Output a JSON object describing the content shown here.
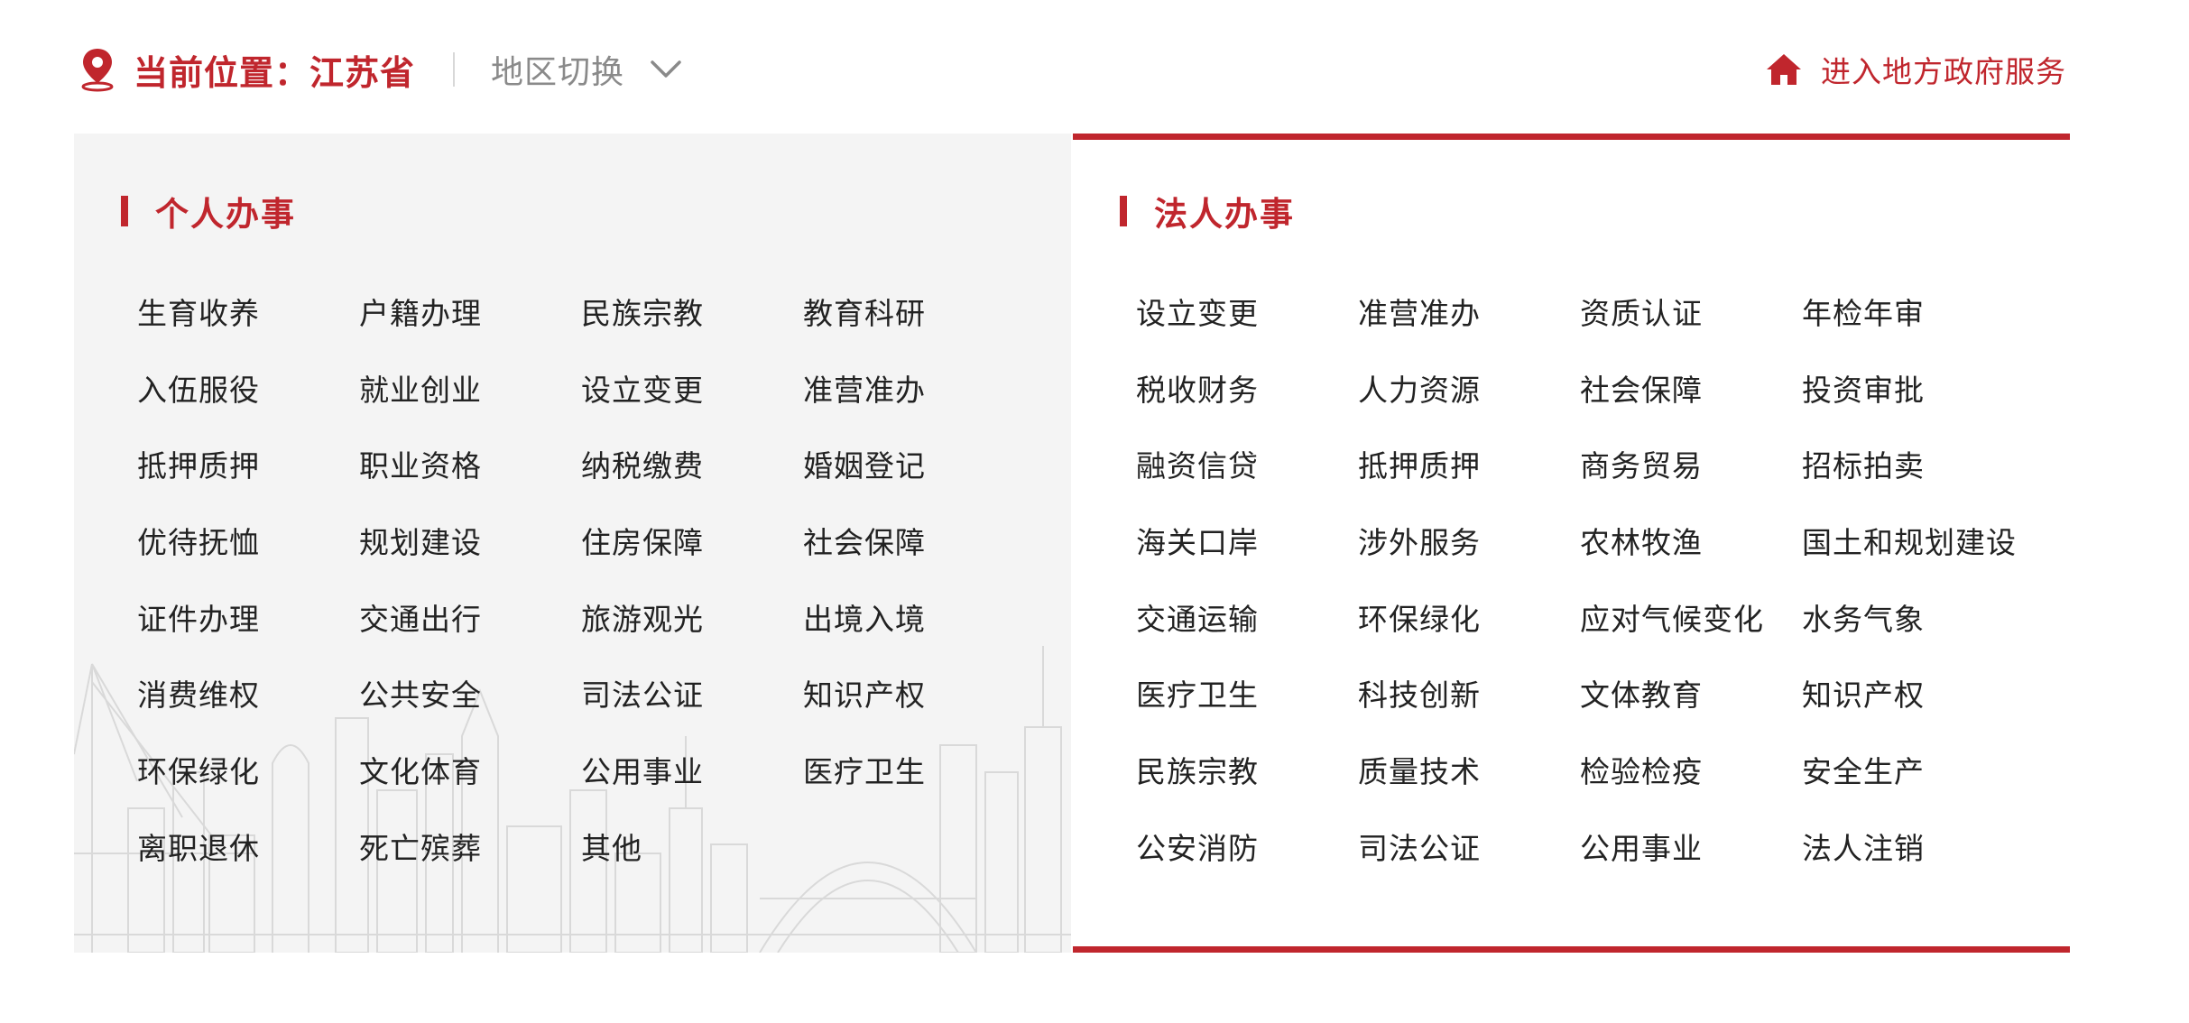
{
  "header": {
    "location_label": "当前位置：",
    "location_value": "江苏省",
    "region_switch_label": "地区切换",
    "gov_link_label": "进入地方政府服务"
  },
  "colors": {
    "accent": "#c0262d",
    "personal_bg": "#f4f4f4",
    "text": "#222222",
    "muted": "#8a8a8a"
  },
  "icons": {
    "location": "map-pin-icon",
    "dropdown": "chevron-down-icon",
    "home": "home-icon"
  },
  "personal": {
    "title": "个人办事",
    "items": [
      "生育收养",
      "户籍办理",
      "民族宗教",
      "教育科研",
      "入伍服役",
      "就业创业",
      "设立变更",
      "准营准办",
      "抵押质押",
      "职业资格",
      "纳税缴费",
      "婚姻登记",
      "优待抚恤",
      "规划建设",
      "住房保障",
      "社会保障",
      "证件办理",
      "交通出行",
      "旅游观光",
      "出境入境",
      "消费维权",
      "公共安全",
      "司法公证",
      "知识产权",
      "环保绿化",
      "文化体育",
      "公用事业",
      "医疗卫生",
      "离职退休",
      "死亡殡葬",
      "其他"
    ]
  },
  "legal": {
    "title": "法人办事",
    "items": [
      "设立变更",
      "准营准办",
      "资质认证",
      "年检年审",
      "税收财务",
      "人力资源",
      "社会保障",
      "投资审批",
      "融资信贷",
      "抵押质押",
      "商务贸易",
      "招标拍卖",
      "海关口岸",
      "涉外服务",
      "农林牧渔",
      "国土和规划建设",
      "交通运输",
      "环保绿化",
      "应对气候变化",
      "水务气象",
      "医疗卫生",
      "科技创新",
      "文体教育",
      "知识产权",
      "民族宗教",
      "质量技术",
      "检验检疫",
      "安全生产",
      "公安消防",
      "司法公证",
      "公用事业",
      "法人注销"
    ]
  }
}
